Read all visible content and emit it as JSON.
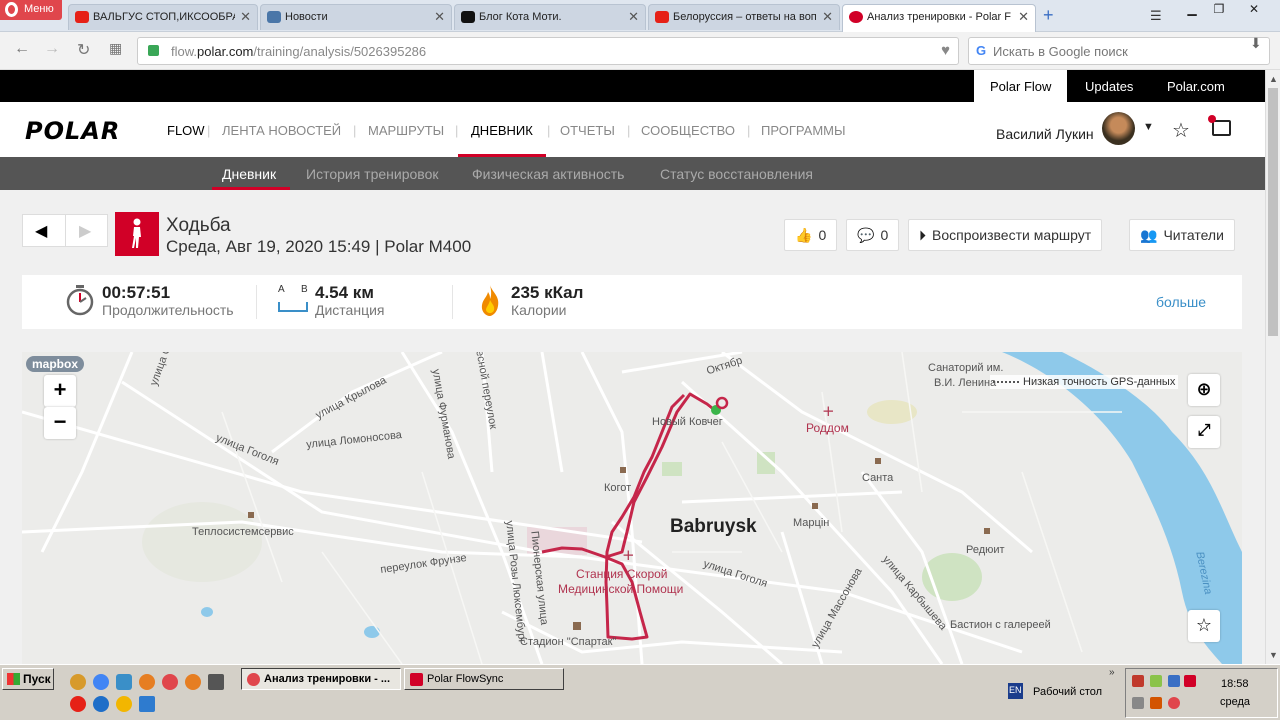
{
  "browser": {
    "menu_label": "Меню",
    "tabs": [
      {
        "title": "ВАЛЬГУС СТОП,ИКСООБРА",
        "color": "#e62117"
      },
      {
        "title": "Новости",
        "color": "#4a76a8"
      },
      {
        "title": "Блог Кота Моти.",
        "color": "#111111"
      },
      {
        "title": "Белоруссия – ответы на воп",
        "color": "#e62117"
      },
      {
        "title": "Анализ тренировки - Polar F",
        "color": "#d10027"
      }
    ],
    "url_prefix": "flow.",
    "url_domain": "polar.com",
    "url_path": "/training/analysis/5026395286",
    "search_placeholder": "Искать в Google поиск"
  },
  "topbar": {
    "links": [
      "Polar Flow",
      "Updates",
      "Polar.com"
    ]
  },
  "nav": {
    "logo": "POLAR",
    "flow": "FLOW",
    "items": [
      "ЛЕНТА НОВОСТЕЙ",
      "МАРШРУТЫ",
      "ДНЕВНИК",
      "ОТЧЕТЫ",
      "СООБЩЕСТВО",
      "ПРОГРАММЫ"
    ],
    "user": "Василий Лукин"
  },
  "subnav": {
    "items": [
      "Дневник",
      "История тренировок",
      "Физическая активность",
      "Статус восстановления"
    ]
  },
  "training": {
    "sport": "Ходьба",
    "subtitle": "Среда, Авг 19, 2020 15:49 | Polar M400",
    "likes": "0",
    "comments": "0",
    "replay_label": "Воспроизвести маршрут",
    "readers_label": "Читатели"
  },
  "stats": {
    "duration_value": "00:57:51",
    "duration_label": "Продолжительность",
    "distance_value": "4.54 км",
    "distance_label": "Дистанция",
    "ab_a": "A",
    "ab_b": "B",
    "calories_value": "235 кКал",
    "calories_label": "Калории",
    "more": "больше"
  },
  "map": {
    "attribution": "mapbox",
    "gps_note": "Низкая точность GPS-данных",
    "city": "Babruysk",
    "labels": {
      "krylova": "улица Крылова",
      "lomonosova": "улица Ломоносова",
      "furmanova": "улица Фурманова",
      "lesnoy": "Лесной переулок",
      "gogolya1": "улица Гоголя",
      "gogolya2": "улица Гоголя",
      "teplo": "Теплосистемсервис",
      "frunze": "переулок Фрунзе",
      "luxemburg": "улица Розы Люксембург",
      "pioner": "Пионерская улица",
      "kogo": "Когот",
      "kovcheg": "Новый Ковчег",
      "oktyabr": "Октябр",
      "marcin": "Марцін",
      "santa": "Санта",
      "sanatoriy": "Санаторий им.",
      "lenina": "В.И. Ленина",
      "rodom": "Роддом",
      "rediut": "Редюит",
      "bastion": "Бастион с галереей",
      "karbysheva": "улица Карбышева",
      "massonova": "улица Массонова",
      "stadion": "Стадион \"Спартак\"",
      "berezina": "Berezina",
      "ulitsa_top": "улица С",
      "station1": "Станция Скорой",
      "station2": "Медицинской Помощи"
    }
  },
  "taskbar": {
    "start": "Пуск",
    "windows": [
      "Анализ тренировки - ...",
      "Polar FlowSync"
    ],
    "lang": "EN",
    "desktop": "Рабочий стол",
    "time": "18:58",
    "day": "среда"
  }
}
